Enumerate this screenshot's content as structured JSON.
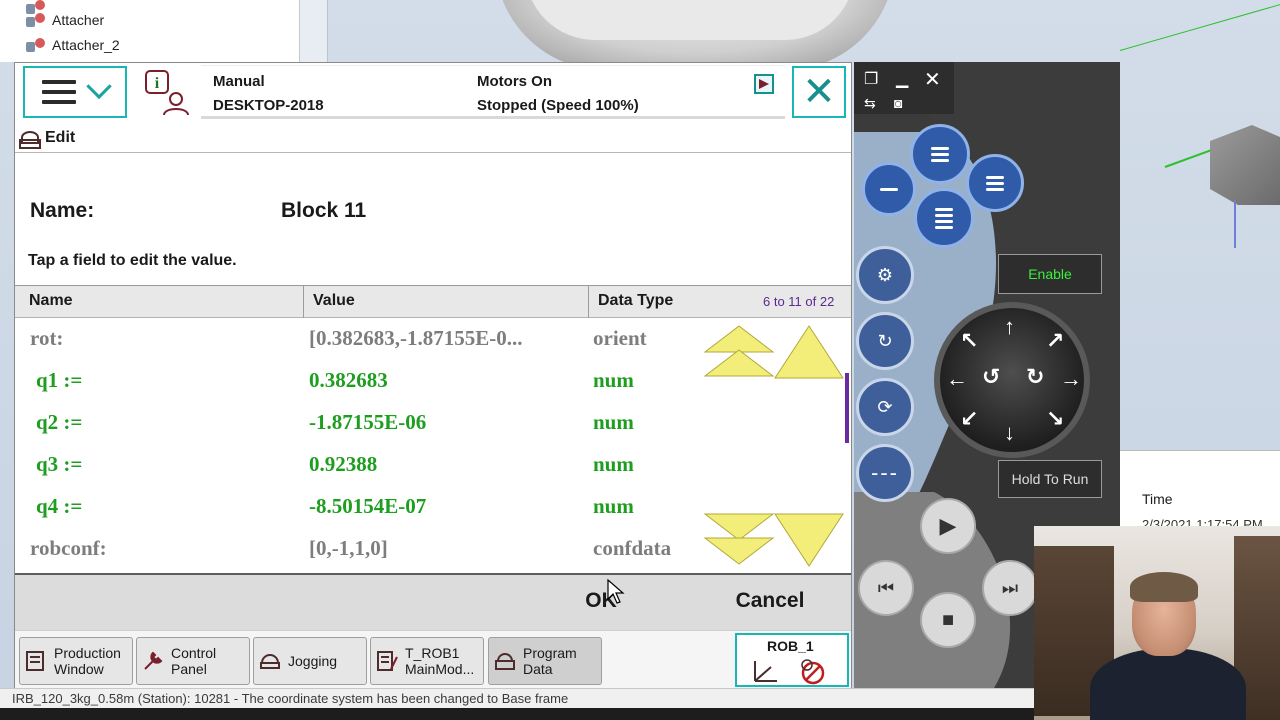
{
  "background_tree": {
    "items": [
      {
        "label": "Attacher"
      },
      {
        "label": "Attacher_2"
      }
    ]
  },
  "header": {
    "mode": "Manual",
    "controller": "DESKTOP-2018",
    "motors": "Motors On",
    "state": "Stopped (Speed 100%)",
    "close_glyph": "✕",
    "icons": [
      "menu-icon",
      "info-user-icon",
      "event-log-icon",
      "close-icon"
    ]
  },
  "app": {
    "title": "Edit"
  },
  "form": {
    "name_label": "Name:",
    "name_value": "Block 11",
    "hint": "Tap a field to edit the value."
  },
  "table": {
    "columns": [
      "Name",
      "Value",
      "Data Type"
    ],
    "range": "6 to 11 of 22",
    "rows": [
      {
        "name": "rot:",
        "value": "[0.382683,-1.87155E-0...",
        "type": "orient",
        "style": "gray"
      },
      {
        "name": "q1 :=",
        "value": "0.382683",
        "type": "num",
        "style": "green"
      },
      {
        "name": "q2 :=",
        "value": "-1.87155E-06",
        "type": "num",
        "style": "green"
      },
      {
        "name": "q3 :=",
        "value": "0.92388",
        "type": "num",
        "style": "green"
      },
      {
        "name": "q4 :=",
        "value": "-8.50154E-07",
        "type": "num",
        "style": "green"
      },
      {
        "name": "robconf:",
        "value": "[0,-1,1,0]",
        "type": "confdata",
        "style": "gray"
      }
    ]
  },
  "buttons": {
    "ok": "OK",
    "cancel": "Cancel"
  },
  "taskbar": {
    "items": [
      {
        "line1": "Production",
        "line2": "Window",
        "icon": "production-window-icon"
      },
      {
        "line1": "Control",
        "line2": "Panel",
        "icon": "control-panel-icon"
      },
      {
        "line1": "Jogging",
        "line2": "",
        "icon": "jogging-icon"
      },
      {
        "line1": "T_ROB1",
        "line2": "MainMod...",
        "icon": "program-editor-icon"
      },
      {
        "line1": "Program",
        "line2": "Data",
        "icon": "program-data-icon"
      }
    ],
    "robot": "ROB_1"
  },
  "hardware": {
    "enable": "Enable",
    "hold_to_run": "Hold To Run"
  },
  "right_panel": {
    "time_label": "Time",
    "timestamp": "2/3/2021 1:17:54 PM"
  },
  "status_line": "IRB_120_3kg_0.58m (Station): 10281 - The coordinate system has been changed to Base frame",
  "colors": {
    "accent": "#19b6b6",
    "green_value": "#1e9e1e",
    "gray_value": "#7d7d7d",
    "scroll_yellow": "#f3ee7a",
    "range_text": "#5b2a91"
  }
}
